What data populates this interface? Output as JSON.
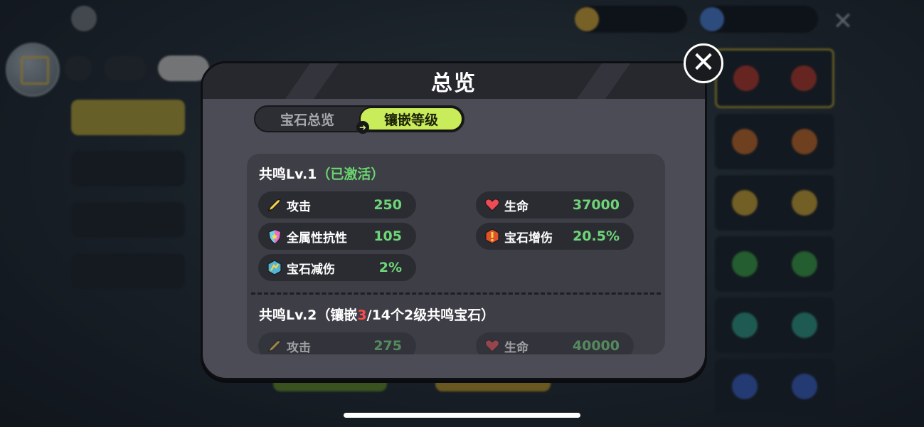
{
  "modal": {
    "title": "总览",
    "tabs": [
      {
        "label": "宝石总览",
        "active": false
      },
      {
        "label": "镶嵌等级",
        "active": true
      }
    ],
    "levels": [
      {
        "title_prefix": "共鸣Lv.1",
        "title_status": "（已激活）",
        "stats_left": [
          {
            "icon": "sword-icon",
            "name": "攻击",
            "value": "250"
          },
          {
            "icon": "all-resistance-shield-icon",
            "name": "全属性抗性",
            "value": "105"
          },
          {
            "icon": "gem-damage-reduction-icon",
            "name": "宝石减伤",
            "value": "2%"
          }
        ],
        "stats_right": [
          {
            "icon": "heart-icon",
            "name": "生命",
            "value": "37000"
          },
          {
            "icon": "gem-damage-boost-icon",
            "name": "宝石增伤",
            "value": "20.5%"
          }
        ]
      },
      {
        "title_prefix": "共鸣Lv.2（镶嵌",
        "title_count": "3",
        "title_suffix": "/14个2级共鸣宝石）",
        "stats_left": [
          {
            "icon": "sword-icon",
            "name": "攻击",
            "value": "275"
          }
        ],
        "stats_right": [
          {
            "icon": "heart-icon",
            "name": "生命",
            "value": "40000"
          }
        ]
      }
    ]
  },
  "colors": {
    "accent_green": "#c9ec5a",
    "value_green": "#6ed678",
    "activated_green": "#6bd670",
    "count_red": "#ff4a4a",
    "modal_bg": "#4b4c55"
  }
}
